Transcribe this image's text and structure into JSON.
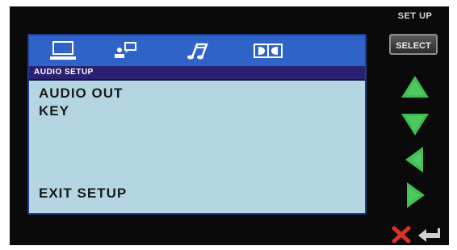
{
  "side_panel": {
    "setup_label": "SET UP",
    "select_label": "SELECT",
    "icons": [
      "up-arrow-icon",
      "down-arrow-icon",
      "left-arrow-icon",
      "right-arrow-icon",
      "close-icon",
      "return-icon"
    ]
  },
  "tabs": [
    {
      "icon": "monitor-icon",
      "active": true
    },
    {
      "icon": "person-speech-icon",
      "active": false
    },
    {
      "icon": "music-note-icon",
      "active": false
    },
    {
      "icon": "dolby-icon",
      "active": false
    }
  ],
  "section": {
    "title": "AUDIO SETUP"
  },
  "menu": {
    "items": [
      "AUDIO OUT",
      "KEY"
    ],
    "exit_label": "EXIT SETUP"
  },
  "colors": {
    "tab_bar": "#2f63c8",
    "header": "#2a2170",
    "panel": "#b4d6e2",
    "arrow_green": "#3fbe52",
    "close_red": "#d9342b"
  }
}
